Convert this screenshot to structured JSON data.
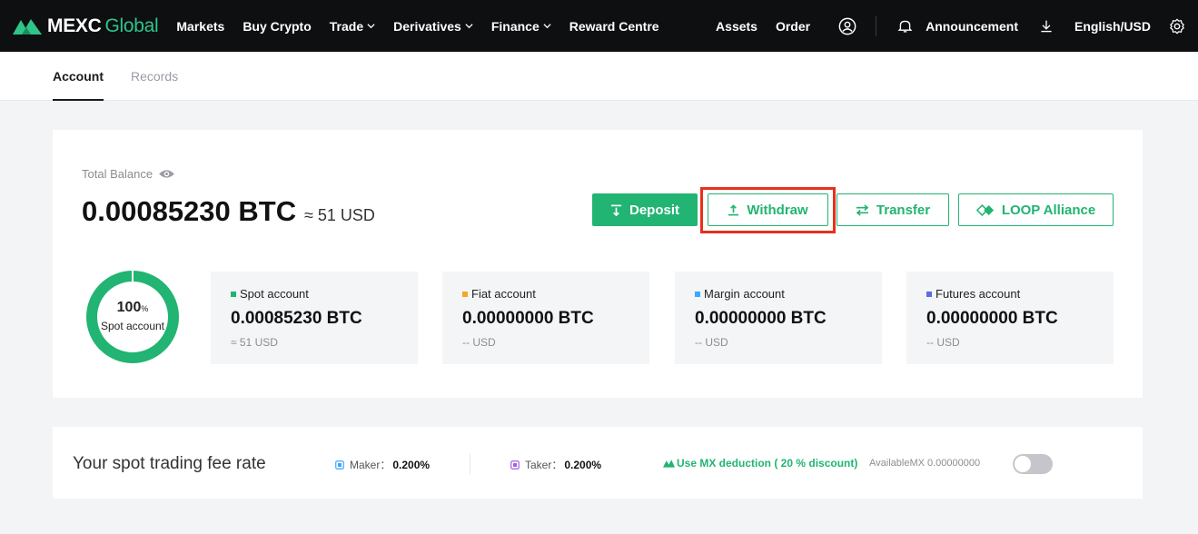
{
  "brand": {
    "name": "MEXC",
    "suffix": "Global",
    "accent": "#22b472"
  },
  "nav": {
    "items": [
      {
        "label": "Markets",
        "dropdown": false
      },
      {
        "label": "Buy Crypto",
        "dropdown": false
      },
      {
        "label": "Trade",
        "dropdown": true
      },
      {
        "label": "Derivatives",
        "dropdown": true
      },
      {
        "label": "Finance",
        "dropdown": true
      },
      {
        "label": "Reward Centre",
        "dropdown": false
      }
    ],
    "right": {
      "assets": "Assets",
      "order": "Order",
      "announcement": "Announcement",
      "language": "English/USD"
    }
  },
  "tabs": {
    "account": "Account",
    "records": "Records"
  },
  "balance": {
    "label": "Total Balance",
    "amount": "0.00085230 BTC",
    "usd": "≈ 51 USD"
  },
  "actions": {
    "deposit": "Deposit",
    "withdraw": "Withdraw",
    "transfer": "Transfer",
    "loop": "LOOP Alliance"
  },
  "donut": {
    "percent": "100",
    "percent_sign": "%",
    "label": "Spot account",
    "fraction": 1.0
  },
  "accounts": [
    {
      "name": "Spot account",
      "balance": "0.00085230 BTC",
      "usd": "≈ 51 USD",
      "color": "#22b472"
    },
    {
      "name": "Fiat account",
      "balance": "0.00000000 BTC",
      "usd": "-- USD",
      "color": "#f5a623"
    },
    {
      "name": "Margin account",
      "balance": "0.00000000 BTC",
      "usd": "-- USD",
      "color": "#3ea6ff"
    },
    {
      "name": "Futures account",
      "balance": "0.00000000 BTC",
      "usd": "-- USD",
      "color": "#5b6be8"
    }
  ],
  "fee": {
    "title": "Your spot trading fee rate",
    "maker_label": "Maker：",
    "maker_value": "0.200%",
    "taker_label": "Taker：",
    "taker_value": "0.200%",
    "mx_deduction": "Use MX deduction ( 20 % discount)",
    "mx_available": "AvailableMX 0.00000000",
    "mx_enabled": false
  }
}
